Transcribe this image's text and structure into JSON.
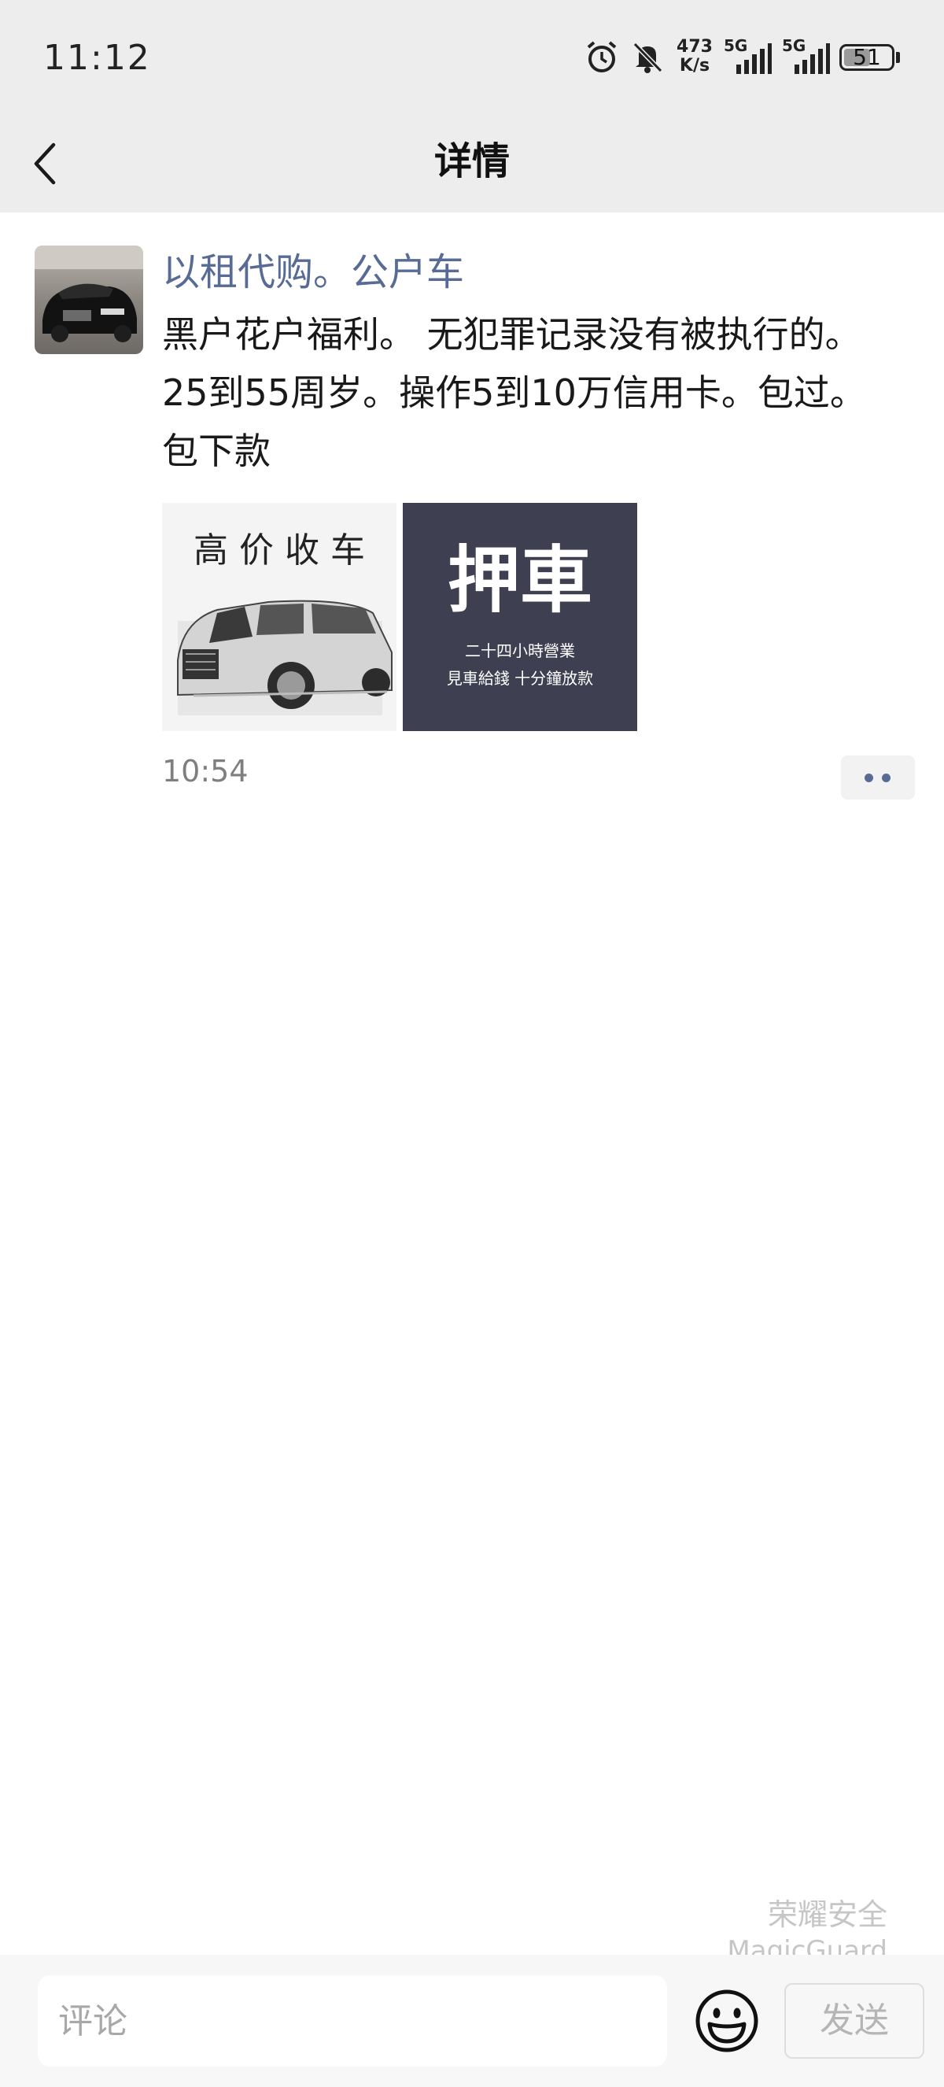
{
  "status_bar": {
    "time": "11:12",
    "net_speed_value": "473",
    "net_speed_unit": "K/s",
    "signal1_label": "5G",
    "signal2_label": "5G",
    "battery_level": "51",
    "icons": [
      "alarm-icon",
      "mute-bell-icon",
      "signal-icon",
      "signal-icon",
      "battery-icon"
    ]
  },
  "nav": {
    "title": "详情",
    "back_icon": "chevron-left-icon"
  },
  "post": {
    "author": "以租代购。公户车",
    "text_lines": [
      "黑户花户福利。 无犯罪记录没有被执行的。",
      "25到55周岁。操作5到10万信用卡。包过。",
      "包下款"
    ],
    "images": [
      {
        "line1": "高 价 收 车"
      },
      {
        "title": "押車",
        "line1": "二十四小時營業",
        "line2": "見車給錢 十分鐘放款"
      }
    ],
    "time": "10:54"
  },
  "watermark": {
    "cn": "荣耀安全",
    "en": "MagicGuard"
  },
  "bottom_bar": {
    "comment_placeholder": "评论",
    "send_label": "发送",
    "emoji_icon": "smiley-icon"
  },
  "colors": {
    "header_bg": "#ededed",
    "link_blue": "#576b95",
    "watermark": "#c6c6c6"
  }
}
